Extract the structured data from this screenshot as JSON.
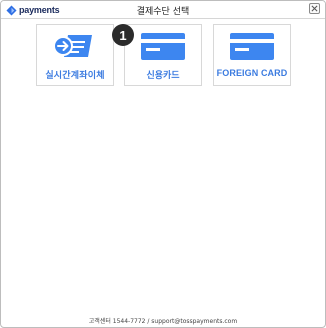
{
  "header": {
    "brand_name": "payments",
    "title": "결제수단 선택",
    "close_label": "X"
  },
  "payment_methods": [
    {
      "label": "실시간계좌이체",
      "icon": "bank-transfer-icon"
    },
    {
      "label": "신용카드",
      "icon": "credit-card-icon"
    },
    {
      "label": "FOREIGN CARD",
      "icon": "credit-card-icon"
    }
  ],
  "step_badge": "1",
  "footer": {
    "text": "고객센터 1544-7772 / support@tosspayments.com"
  },
  "colors": {
    "accent": "#3b7be0",
    "icon_blue": "#3d86f0",
    "badge_bg": "#2b2b2b",
    "border": "#d8d8d8"
  }
}
